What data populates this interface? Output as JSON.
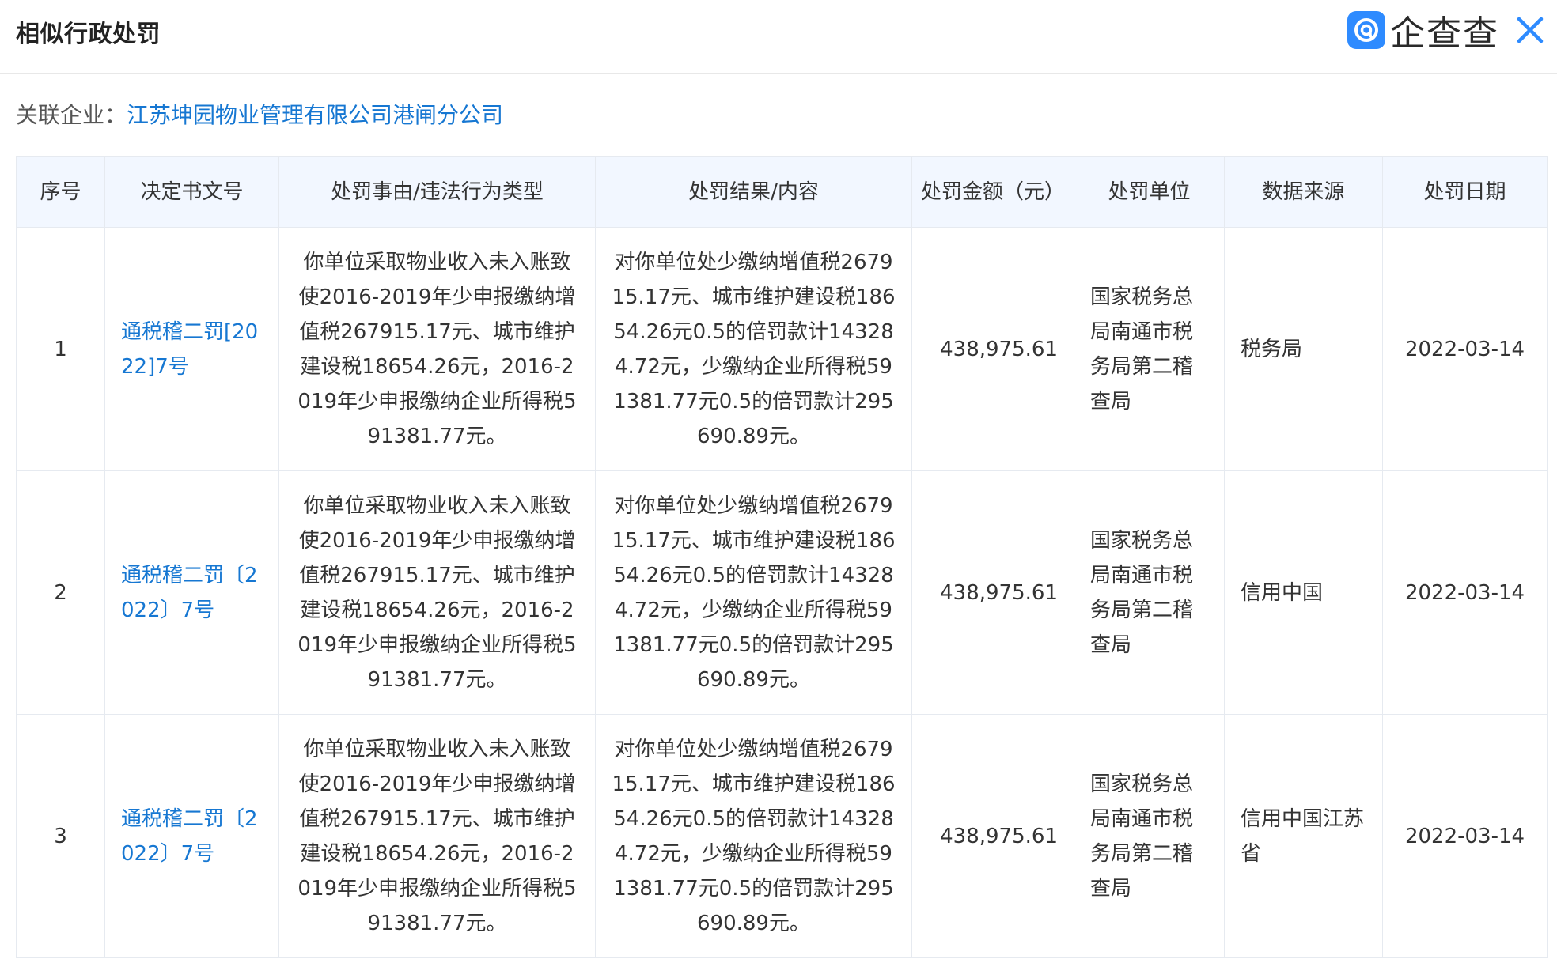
{
  "header": {
    "title": "相似行政处罚",
    "brand_name": "企查查",
    "brand_icon": "qichacha-logo-icon",
    "close_icon": "close-icon",
    "accent": "#2e8bff"
  },
  "related": {
    "label": "关联企业：",
    "company": "江苏坤园物业管理有限公司港闸分公司"
  },
  "table": {
    "columns": [
      "序号",
      "决定书文号",
      "处罚事由/违法行为类型",
      "处罚结果/内容",
      "处罚金额（元）",
      "处罚单位",
      "数据来源",
      "处罚日期"
    ],
    "rows": [
      {
        "index": "1",
        "doc_no": "通税稽二罚[2022]7号",
        "reason": "你单位采取物业收入未入账致使2016-2019年少申报缴纳增值税267915.17元、城市维护建设税18654.26元，2016-2019年少申报缴纳企业所得税591381.77元。",
        "result": "对你单位处少缴纳增值税267915.17元、城市维护建设税18654.26元0.5的倍罚款计143284.72元，少缴纳企业所得税591381.77元0.5的倍罚款计295690.89元。",
        "amount": "438,975.61",
        "unit": "国家税务总局南通市税务局第二稽查局",
        "source": "税务局",
        "date": "2022-03-14"
      },
      {
        "index": "2",
        "doc_no": "通税稽二罚〔2022〕7号",
        "reason": "你单位采取物业收入未入账致使2016-2019年少申报缴纳增值税267915.17元、城市维护建设税18654.26元，2016-2019年少申报缴纳企业所得税591381.77元。",
        "result": "对你单位处少缴纳增值税267915.17元、城市维护建设税18654.26元0.5的倍罚款计143284.72元，少缴纳企业所得税591381.77元0.5的倍罚款计295690.89元。",
        "amount": "438,975.61",
        "unit": "国家税务总局南通市税务局第二稽查局",
        "source": "信用中国",
        "date": "2022-03-14"
      },
      {
        "index": "3",
        "doc_no": "通税稽二罚〔2022〕7号",
        "reason": "你单位采取物业收入未入账致使2016-2019年少申报缴纳增值税267915.17元、城市维护建设税18654.26元，2016-2019年少申报缴纳企业所得税591381.77元。",
        "result": "对你单位处少缴纳增值税267915.17元、城市维护建设税18654.26元0.5的倍罚款计143284.72元，少缴纳企业所得税591381.77元0.5的倍罚款计295690.89元。",
        "amount": "438,975.61",
        "unit": "国家税务总局南通市税务局第二稽查局",
        "source": "信用中国江苏省",
        "date": "2022-03-14"
      }
    ]
  }
}
